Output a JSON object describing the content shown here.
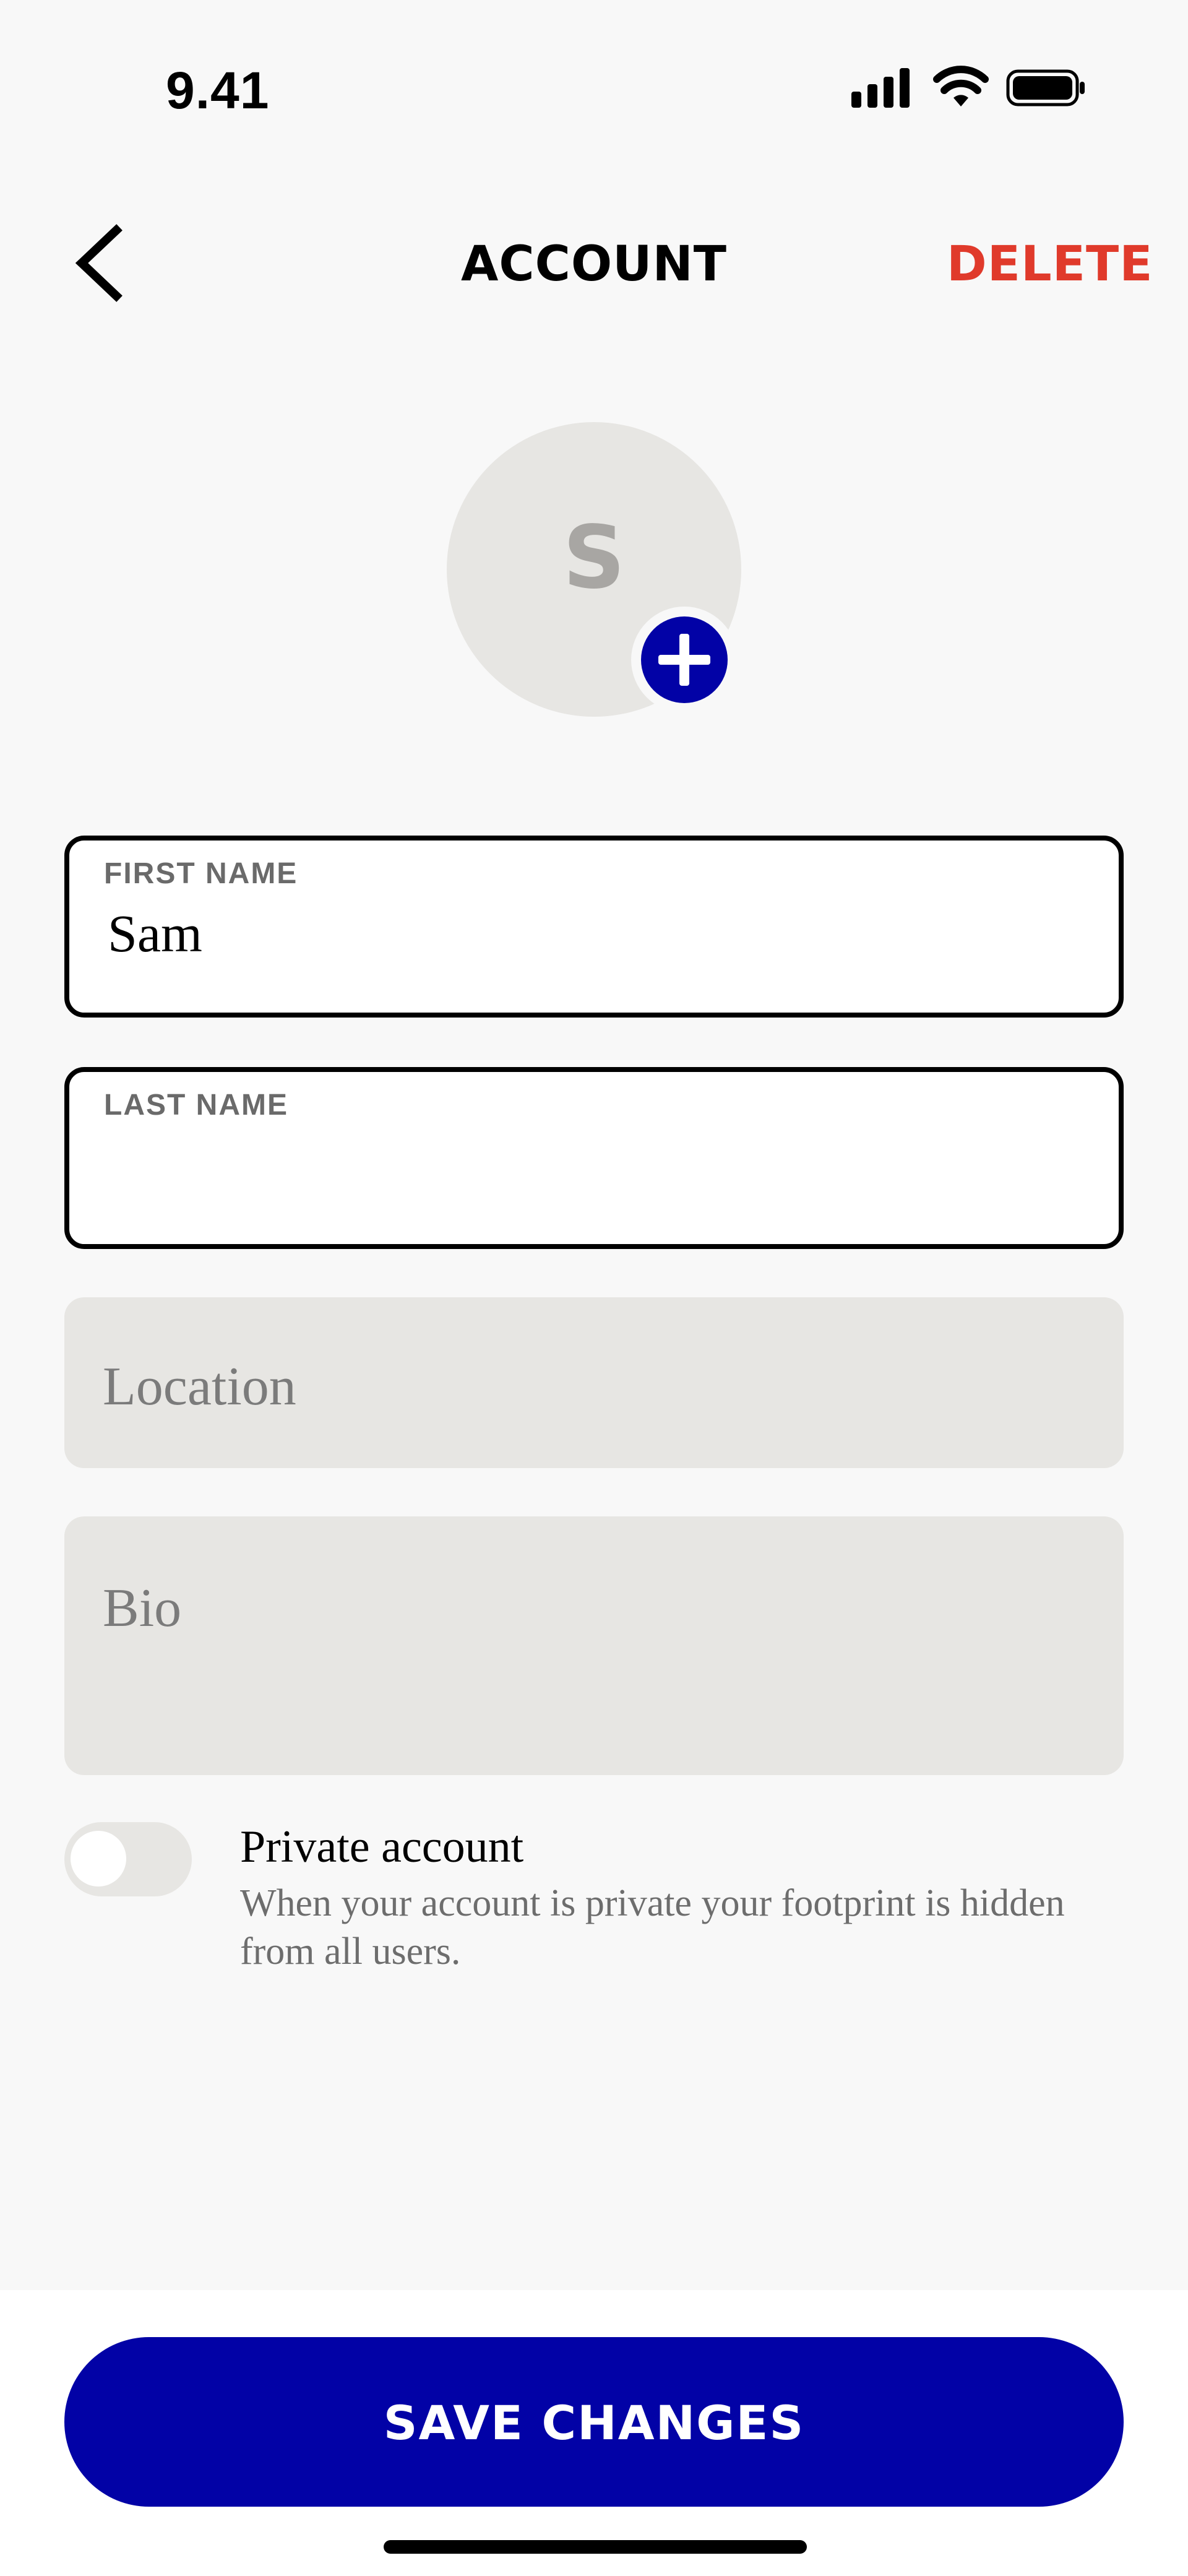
{
  "status_bar": {
    "time": "9.41",
    "icons": [
      "signal-icon",
      "wifi-icon",
      "battery-icon"
    ]
  },
  "header": {
    "back_icon": "chevron-left-icon",
    "title": "ACCOUNT",
    "delete_label": "DELETE"
  },
  "avatar": {
    "initial": "S",
    "add_icon": "plus-circle-icon"
  },
  "form": {
    "first_name": {
      "label": "FIRST NAME",
      "value": "Sam"
    },
    "last_name": {
      "label": "LAST NAME",
      "value": ""
    },
    "location": {
      "placeholder": "Location"
    },
    "bio": {
      "placeholder": "Bio"
    }
  },
  "privacy": {
    "toggle_on": false,
    "title": "Private account",
    "description": "When your account is private your footprint is hidden from all users."
  },
  "footer": {
    "save_label": "SAVE CHANGES"
  },
  "colors": {
    "accent": "#0202a6",
    "danger": "#e03a2b",
    "input_fill": "#e7e6e3",
    "background": "#f8f8f8"
  }
}
